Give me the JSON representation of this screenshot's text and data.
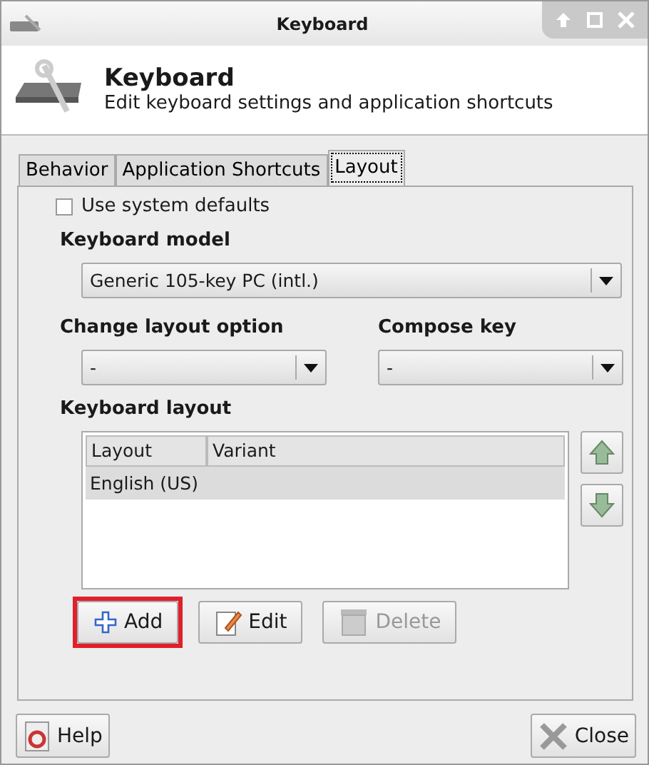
{
  "window": {
    "title": "Keyboard"
  },
  "header": {
    "title": "Keyboard",
    "subtitle": "Edit keyboard settings and application shortcuts"
  },
  "tabs": [
    {
      "label": "Behavior",
      "selected": false
    },
    {
      "label": "Application Shortcuts",
      "selected": false
    },
    {
      "label": "Layout",
      "selected": true
    }
  ],
  "use_system_defaults": {
    "label": "Use system defaults",
    "checked": false
  },
  "keyboard_model": {
    "label": "Keyboard model",
    "value": "Generic 105-key PC (intl.)"
  },
  "change_layout_option": {
    "label": "Change layout option",
    "value": "-"
  },
  "compose_key": {
    "label": "Compose key",
    "value": "-"
  },
  "keyboard_layout": {
    "label": "Keyboard layout",
    "columns": [
      "Layout",
      "Variant"
    ],
    "rows": [
      {
        "layout": "English (US)",
        "variant": "",
        "selected": true
      }
    ]
  },
  "layout_buttons": [
    {
      "kind": "add",
      "label": "Add",
      "disabled": false,
      "highlighted": true
    },
    {
      "kind": "edit",
      "label": "Edit",
      "disabled": false,
      "highlighted": false
    },
    {
      "kind": "delete",
      "label": "Delete",
      "disabled": true,
      "highlighted": false
    }
  ],
  "footer_buttons": [
    {
      "kind": "help",
      "label": "Help"
    },
    {
      "kind": "close",
      "label": "Close"
    }
  ]
}
